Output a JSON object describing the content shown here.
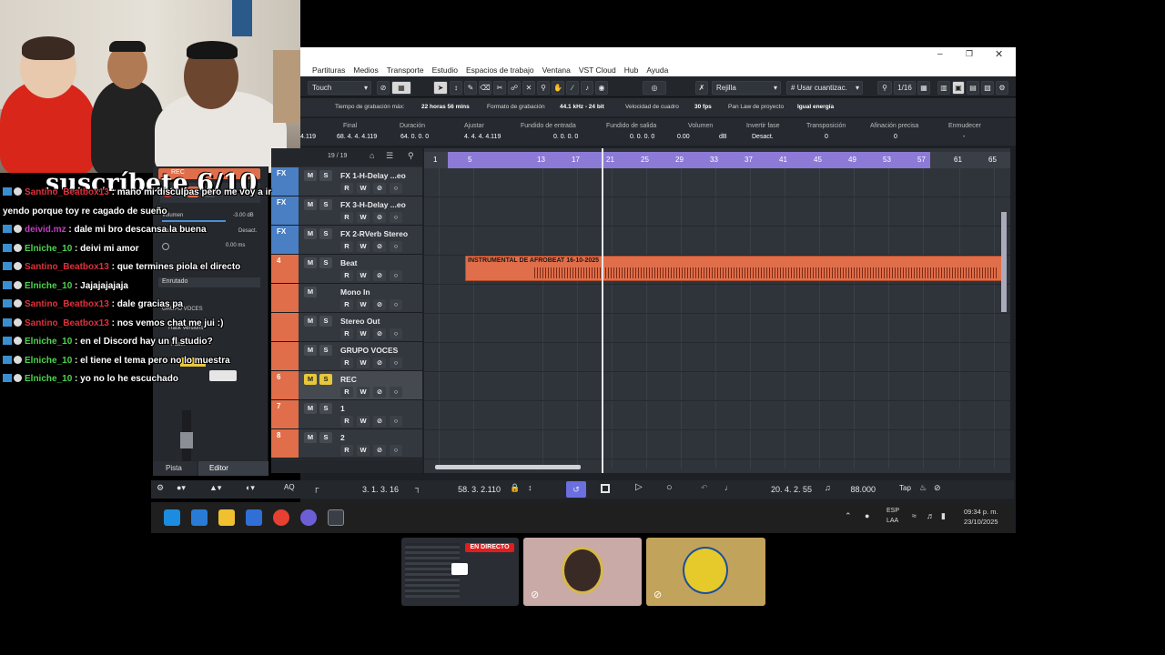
{
  "overlay": {
    "subscribe": "suscríbete 6/10"
  },
  "chat": [
    {
      "user": "Santino_Beatbox13",
      "sep": " : ",
      "text": "mano mi disculpas pero me voy a ir",
      "color": "#e0303c"
    },
    {
      "user": "",
      "sep": "",
      "text": "yendo porque toy re cagado de sueño",
      "color": "#e0303c"
    },
    {
      "user": "deivid.mz",
      "sep": " : ",
      "text": "dale mi bro descansa la buena",
      "color": "#c43cc4"
    },
    {
      "user": "Elniche_10",
      "sep": " : ",
      "text": "deivi mi amor",
      "color": "#4cd44c"
    },
    {
      "user": "Santino_Beatbox13",
      "sep": " : ",
      "text": "que termines piola el directo",
      "color": "#e0303c"
    },
    {
      "user": "Elniche_10",
      "sep": " : ",
      "text": "Jajajajajaja",
      "color": "#4cd44c"
    },
    {
      "user": "Santino_Beatbox13",
      "sep": " : ",
      "text": "dale gracias pa",
      "color": "#e0303c"
    },
    {
      "user": "Santino_Beatbox13",
      "sep": " : ",
      "text": "nos vemos chat me jui :)",
      "color": "#e0303c"
    },
    {
      "user": "Elniche_10",
      "sep": " : ",
      "text": "en el Discord hay un fl studio?",
      "color": "#4cd44c"
    },
    {
      "user": "Elniche_10",
      "sep": " : ",
      "text": "el tiene el tema pero no lo muestra",
      "color": "#4cd44c"
    },
    {
      "user": "Elniche_10",
      "sep": " : ",
      "text": "yo no lo he escuchado",
      "color": "#4cd44c"
    }
  ],
  "daw": {
    "menu": [
      "Partituras",
      "Medios",
      "Transporte",
      "Estudio",
      "Espacios de trabajo",
      "Ventana",
      "VST Cloud",
      "Hub",
      "Ayuda"
    ],
    "toolbar": {
      "touch": "Touch",
      "grid": "Rejilla",
      "quantize": "Usar cuantizac.",
      "quant_value": "1/16"
    },
    "info": {
      "rec_time_label": "Tiempo de grabación máx:",
      "rec_time_value": "22 horas 56 mins",
      "format_label": "Formato de grabación",
      "format_value": "44.1 kHz - 24 bit",
      "fps_label": "Velocidad de cuadro",
      "fps_value": "30 fps",
      "pan_label": "Pan Law de proyecto",
      "pan_value": "Igual energía"
    },
    "event_headers": [
      "Final",
      "Duración",
      "Ajustar",
      "Fundido de entrada",
      "Fundido de salida",
      "Volumen",
      "Invertir fase",
      "Transposición",
      "Afinación precisa",
      "Enmudecer"
    ],
    "event_values": [
      "4.119",
      "68. 4. 4. 4.119",
      "64. 0. 0. 0",
      "4. 4. 4. 4.119",
      "0. 0. 0. 0",
      "0. 0. 0. 0",
      "0.00",
      "dB",
      "Desact.",
      "0",
      "0",
      "-"
    ],
    "inspector": {
      "track_name": "REC",
      "volume_label": "Volumen",
      "volume_value": "-3.00 dB",
      "pan_label": "Pan",
      "pan_value": "Desact.",
      "delay_value": "0.00 ms",
      "routing": "Enrutado",
      "group": "GRUPO VOCES",
      "track_versions": "Track Versions",
      "fader": "Fader",
      "tab_track": "Pista",
      "tab_editor": "Editor",
      "count": "19 / 19"
    },
    "tracks": [
      {
        "name": "FX 1-H-Delay ...eo",
        "type": "FX",
        "color": "#4a7fc4"
      },
      {
        "name": "FX 3-H-Delay ...eo",
        "type": "FX",
        "color": "#4a7fc4"
      },
      {
        "name": "FX 2-RVerb Stereo",
        "type": "FX",
        "color": "#4a7fc4"
      },
      {
        "name": "Beat",
        "type": "4",
        "color": "#e06e4a"
      },
      {
        "name": "Mono In",
        "type": "",
        "color": "#e06e4a"
      },
      {
        "name": "Stereo Out",
        "type": "",
        "color": "#e06e4a"
      },
      {
        "name": "GRUPO VOCES",
        "type": "",
        "color": "#e06e4a"
      },
      {
        "name": "REC",
        "type": "6",
        "color": "#e06e4a"
      },
      {
        "name": "1",
        "type": "7",
        "color": "#e06e4a"
      },
      {
        "name": "2",
        "type": "8",
        "color": "#e06e4a"
      }
    ],
    "ruler": [
      "1",
      "5",
      "13",
      "17",
      "21",
      "25",
      "29",
      "33",
      "37",
      "41",
      "45",
      "49",
      "53",
      "57",
      "61",
      "65"
    ],
    "clip_label": "INSTRUMENTAL DE AFROBEAT 16-10-2025",
    "transport": {
      "left_locator": "3. 1. 3. 16",
      "right_locator": "58. 3. 2.110",
      "position": "20. 4. 2. 55",
      "tempo": "88.000",
      "tap": "Tap"
    }
  },
  "taskbar": {
    "lang": "ESP",
    "region": "LAA",
    "time": "09:34 p. m.",
    "date": "23/10/2025"
  },
  "tiles": {
    "live_badge": "EN DIRECTO"
  },
  "colors": {
    "accent": "#8c7ad6",
    "track_audio": "#e06e4a",
    "track_fx": "#4a7fc4"
  }
}
